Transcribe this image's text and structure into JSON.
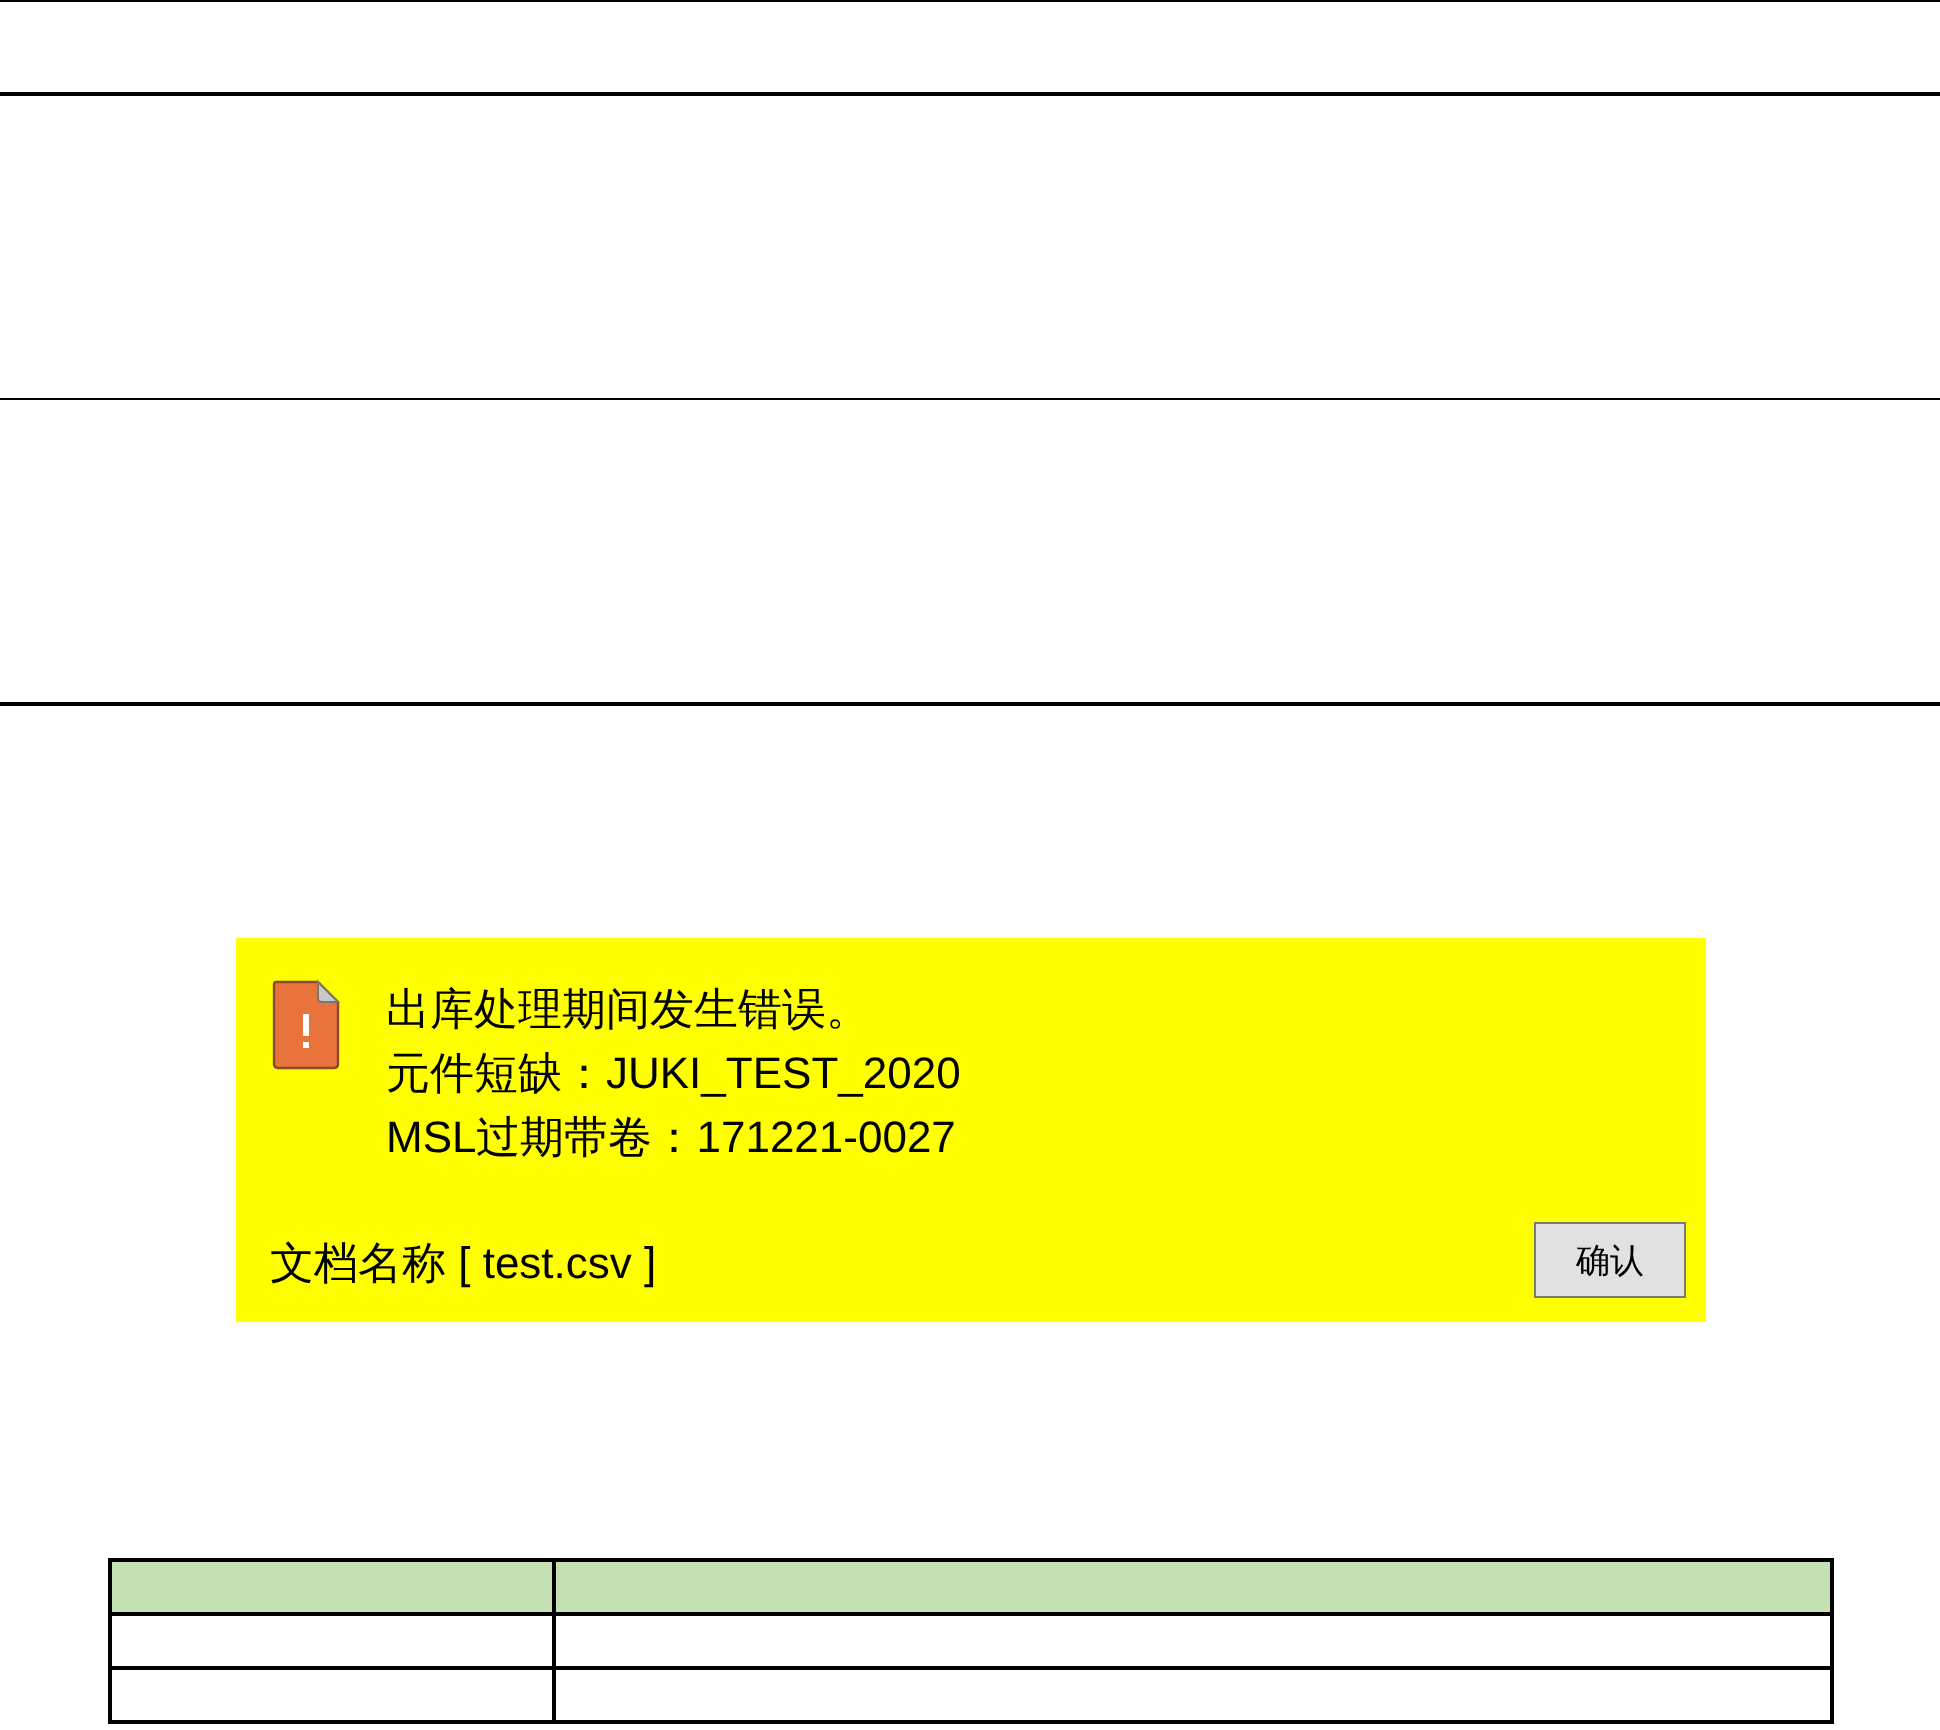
{
  "dialog": {
    "message_lines": [
      "出库处理期间发生错误。",
      "元件短缺：JUKI_TEST_2020",
      "MSL过期带卷：171221-0027"
    ],
    "file_label": "文档名称 [ test.csv ]",
    "buttons": [
      "确认"
    ]
  }
}
